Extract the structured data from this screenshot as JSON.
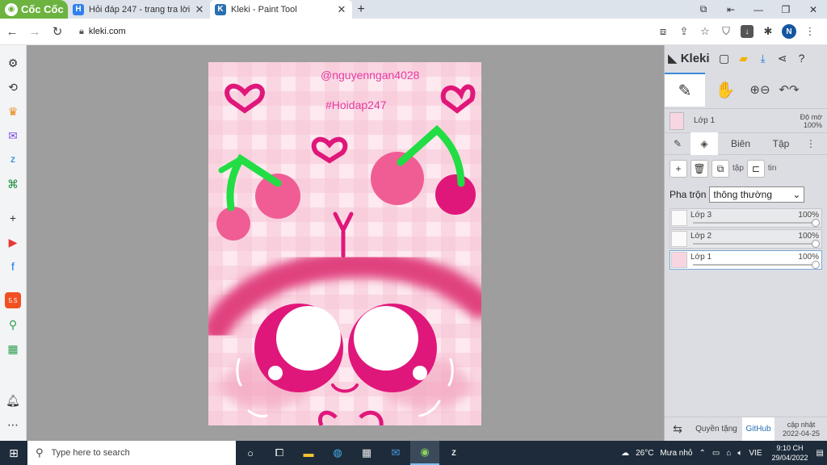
{
  "browser": {
    "brand": "Cốc Cốc",
    "tabs": [
      {
        "title": "Hỏi đáp 247 - trang tra lời",
        "favicon": "H",
        "favicon_color": "#2f80ed",
        "active": false
      },
      {
        "title": "Kleki - Paint Tool",
        "favicon": "K",
        "favicon_color": "#2a6fb0",
        "active": true
      }
    ],
    "url": "kleki.com",
    "profile_initial": "N",
    "window_controls": [
      "restore-icon",
      "back-to-icon",
      "minimize-icon",
      "maximize-icon",
      "close-icon"
    ]
  },
  "canvas": {
    "watermark_user": "@nguyenngan4028",
    "watermark_tag": "#Hoidap247",
    "accent_pink": "#e0177a",
    "light_pink": "#fbe2ea",
    "cherry_pink": "#f05d95",
    "stem_green": "#22dd44"
  },
  "kleki": {
    "logo": "Kleki",
    "layer_info": {
      "name": "Lớp 1",
      "opacity_label": "Độ mờ",
      "opacity": "100%"
    },
    "subtabs": [
      "Biên",
      "Tập"
    ],
    "layer_buttons_text": [
      "tập",
      "tin"
    ],
    "blend_label": "Pha trộn",
    "blend_value": "thông thường",
    "layers": [
      {
        "name": "Lớp 3",
        "opacity": "100%",
        "active": false
      },
      {
        "name": "Lớp 2",
        "opacity": "100%",
        "active": false
      },
      {
        "name": "Lớp 1",
        "opacity": "100%",
        "active": true
      }
    ],
    "footer": {
      "privacy": "Quyền tặng",
      "github": "GitHub",
      "update_label": "cập nhật",
      "update_date": "2022-04-25"
    }
  },
  "taskbar": {
    "search_placeholder": "Type here to search",
    "temperature": "26°C",
    "weather": "Mưa nhỏ",
    "language": "VIE",
    "time": "9:10 CH",
    "date": "29/04/2022"
  }
}
